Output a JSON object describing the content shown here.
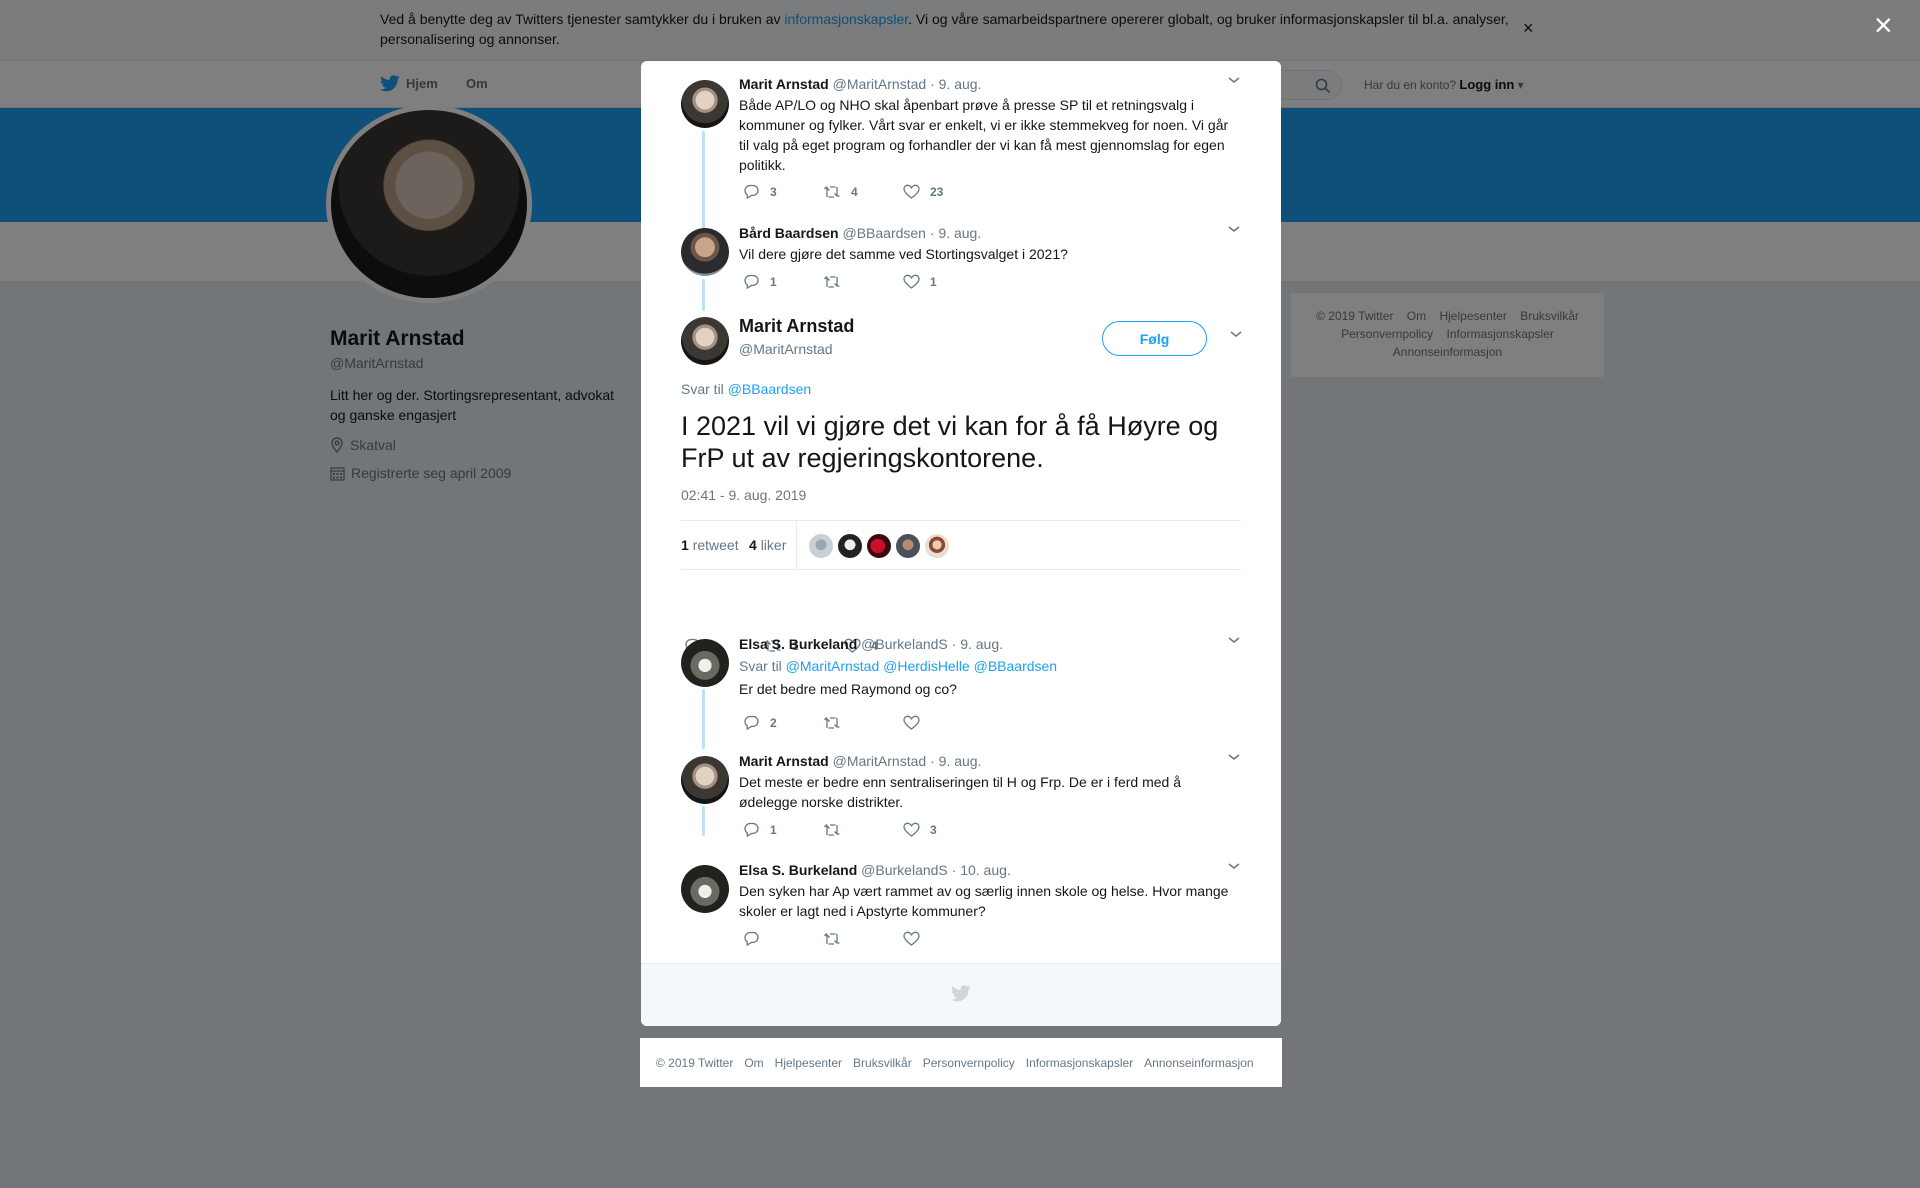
{
  "cookie_bar": {
    "text_before": "Ved å benytte deg av Twitters tjenester samtykker du i bruken av ",
    "link": "informasjonskapsler",
    "text_after": ". Vi og våre samarbeidspartnere opererer globalt, og bruker informasjonskapsler til bl.a. analyser, personalisering og annonser.",
    "close": "×"
  },
  "topnav": {
    "home": "Hjem",
    "about": "Om",
    "account_q": "Har du en konto?",
    "login": "Logg inn"
  },
  "profile": {
    "name": "Marit Arnstad",
    "handle": "@MaritArnstad",
    "bio": "Litt her og der. Stortingsrepresentant, advokat og ganske engasjert",
    "location": "Skatval",
    "joined": "Registrerte seg april 2009"
  },
  "side_footer": [
    "© 2019 Twitter",
    "Om",
    "Hjelpesenter",
    "Bruksvilkår",
    "Personvernpolicy",
    "Informasjonskapsler",
    "Annonseinformasjon"
  ],
  "overlay_close": "×",
  "thread_above": [
    {
      "name": "Marit Arnstad",
      "handle": "@MaritArnstad",
      "date": "· 9. aug.",
      "text": "Både AP/LO og NHO skal åpenbart prøve å presse SP til et retningsvalg i kommuner og fylker. Vårt svar er enkelt, vi er ikke stemmekveg for noen. Vi går til valg på eget program og forhandler der vi kan få mest gjennomslag for egen politikk.",
      "replies": "3",
      "retweets": "4",
      "likes": "23"
    },
    {
      "name": "Bård Baardsen",
      "handle": "@BBaardsen",
      "date": "· 9. aug.",
      "text": "Vil dere gjøre det samme ved Stortingsvalget i 2021?",
      "replies": "1",
      "retweets": "",
      "likes": "1"
    }
  ],
  "main_tweet": {
    "name": "Marit Arnstad",
    "handle": "@MaritArnstad",
    "follow": "Følg",
    "reply_prefix": "Svar til ",
    "reply_handle": "@BBaardsen",
    "text": "I 2021 vil vi gjøre det vi kan for å få Høyre og FrP ut av regjeringskontorene.",
    "time": "02:41 - 9. aug. 2019",
    "retweet_count": "1",
    "retweet_label": "retweet",
    "like_count": "4",
    "like_label": "liker",
    "replies": "1",
    "retweets": "1",
    "likes": "4"
  },
  "replies": [
    {
      "name": "Elsa S. Burkeland",
      "handle": "@BurkelandS",
      "date": "· 9. aug.",
      "reply_prefix": "Svar til ",
      "reply_handles": "@MaritArnstad @HerdisHelle @BBaardsen",
      "text": "Er det bedre med Raymond og co?",
      "replies": "2",
      "retweets": "",
      "likes": ""
    },
    {
      "name": "Marit Arnstad",
      "handle": "@MaritArnstad",
      "date": "· 9. aug.",
      "text": "Det meste er bedre enn sentraliseringen til H og Frp.  De er i ferd med å ødelegge norske distrikter.",
      "replies": "1",
      "retweets": "",
      "likes": "3"
    },
    {
      "name": "Elsa S. Burkeland",
      "handle": "@BurkelandS",
      "date": "· 10. aug.",
      "text": "Den syken har Ap vært rammet av og særlig innen skole og helse. Hvor mange skoler er lagt ned i Apstyrte kommuner?",
      "replies": "",
      "retweets": "",
      "likes": ""
    }
  ],
  "bottom_footer": [
    "© 2019 Twitter",
    "Om",
    "Hjelpesenter",
    "Bruksvilkår",
    "Personvernpolicy",
    "Informasjonskapsler",
    "Annonseinformasjon"
  ],
  "colors": {
    "accent": "#1da1f2",
    "thread_line": "#bee1f7",
    "muted": "#657786"
  }
}
